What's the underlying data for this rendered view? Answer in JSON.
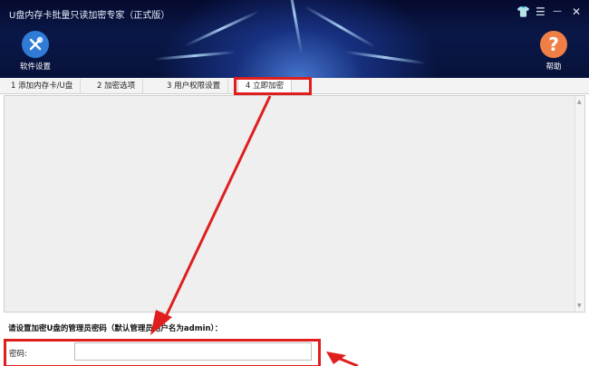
{
  "window": {
    "title": "U盘内存卡批量只读加密专家（正式版）",
    "controls": {
      "skin": "👕",
      "menu": "☰",
      "minimize": "—",
      "close": "✕"
    }
  },
  "toolbar": {
    "settings_label": "软件设置",
    "help_label": "帮助"
  },
  "tabs": [
    {
      "label": "1 添加内存卡/U盘"
    },
    {
      "label": "2 加密选项"
    },
    {
      "label": "3 用户权限设置"
    },
    {
      "label": "4 立即加密"
    }
  ],
  "main": {
    "prompt": "请设置加密U盘的管理员密码（默认管理员用户名为admin）：",
    "password_label": "密码:",
    "password_value": ""
  },
  "colors": {
    "accent_red": "#e01e1e",
    "settings_blue": "#2f7bd6",
    "help_orange": "#f07f46"
  }
}
